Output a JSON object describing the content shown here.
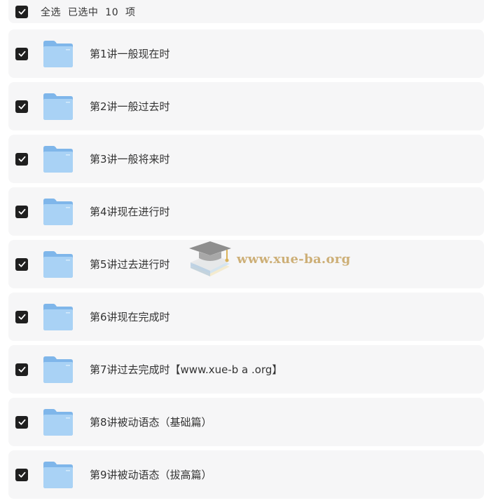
{
  "header": {
    "select_all_label": "全选  已选中  10  项",
    "checked": true
  },
  "rows": [
    {
      "name": "第1讲一般现在时",
      "checked": true
    },
    {
      "name": "第2讲一般过去时",
      "checked": true
    },
    {
      "name": "第3讲一般将来时",
      "checked": true
    },
    {
      "name": "第4讲现在进行时",
      "checked": true
    },
    {
      "name": "第5讲过去进行时",
      "checked": true
    },
    {
      "name": "第6讲现在完成时",
      "checked": true
    },
    {
      "name": "第7讲过去完成时【www.xue-b a .org】",
      "checked": true
    },
    {
      "name": "第8讲被动语态（基础篇）",
      "checked": true
    },
    {
      "name": "第9讲被动语态（拔高篇）",
      "checked": true
    }
  ],
  "watermark": {
    "text": "www.xue-ba.org"
  },
  "colors": {
    "row_bg": "#f6f6f7",
    "checkbox": "#1f1f1f",
    "folder_back": "#7fb6ea",
    "folder_front": "#a9d2f5",
    "watermark_text": "#c9a86a"
  },
  "icons": {
    "checkbox": "checkmark-icon",
    "folder": "folder-icon",
    "watermark": "graduation-cap-books-icon"
  }
}
